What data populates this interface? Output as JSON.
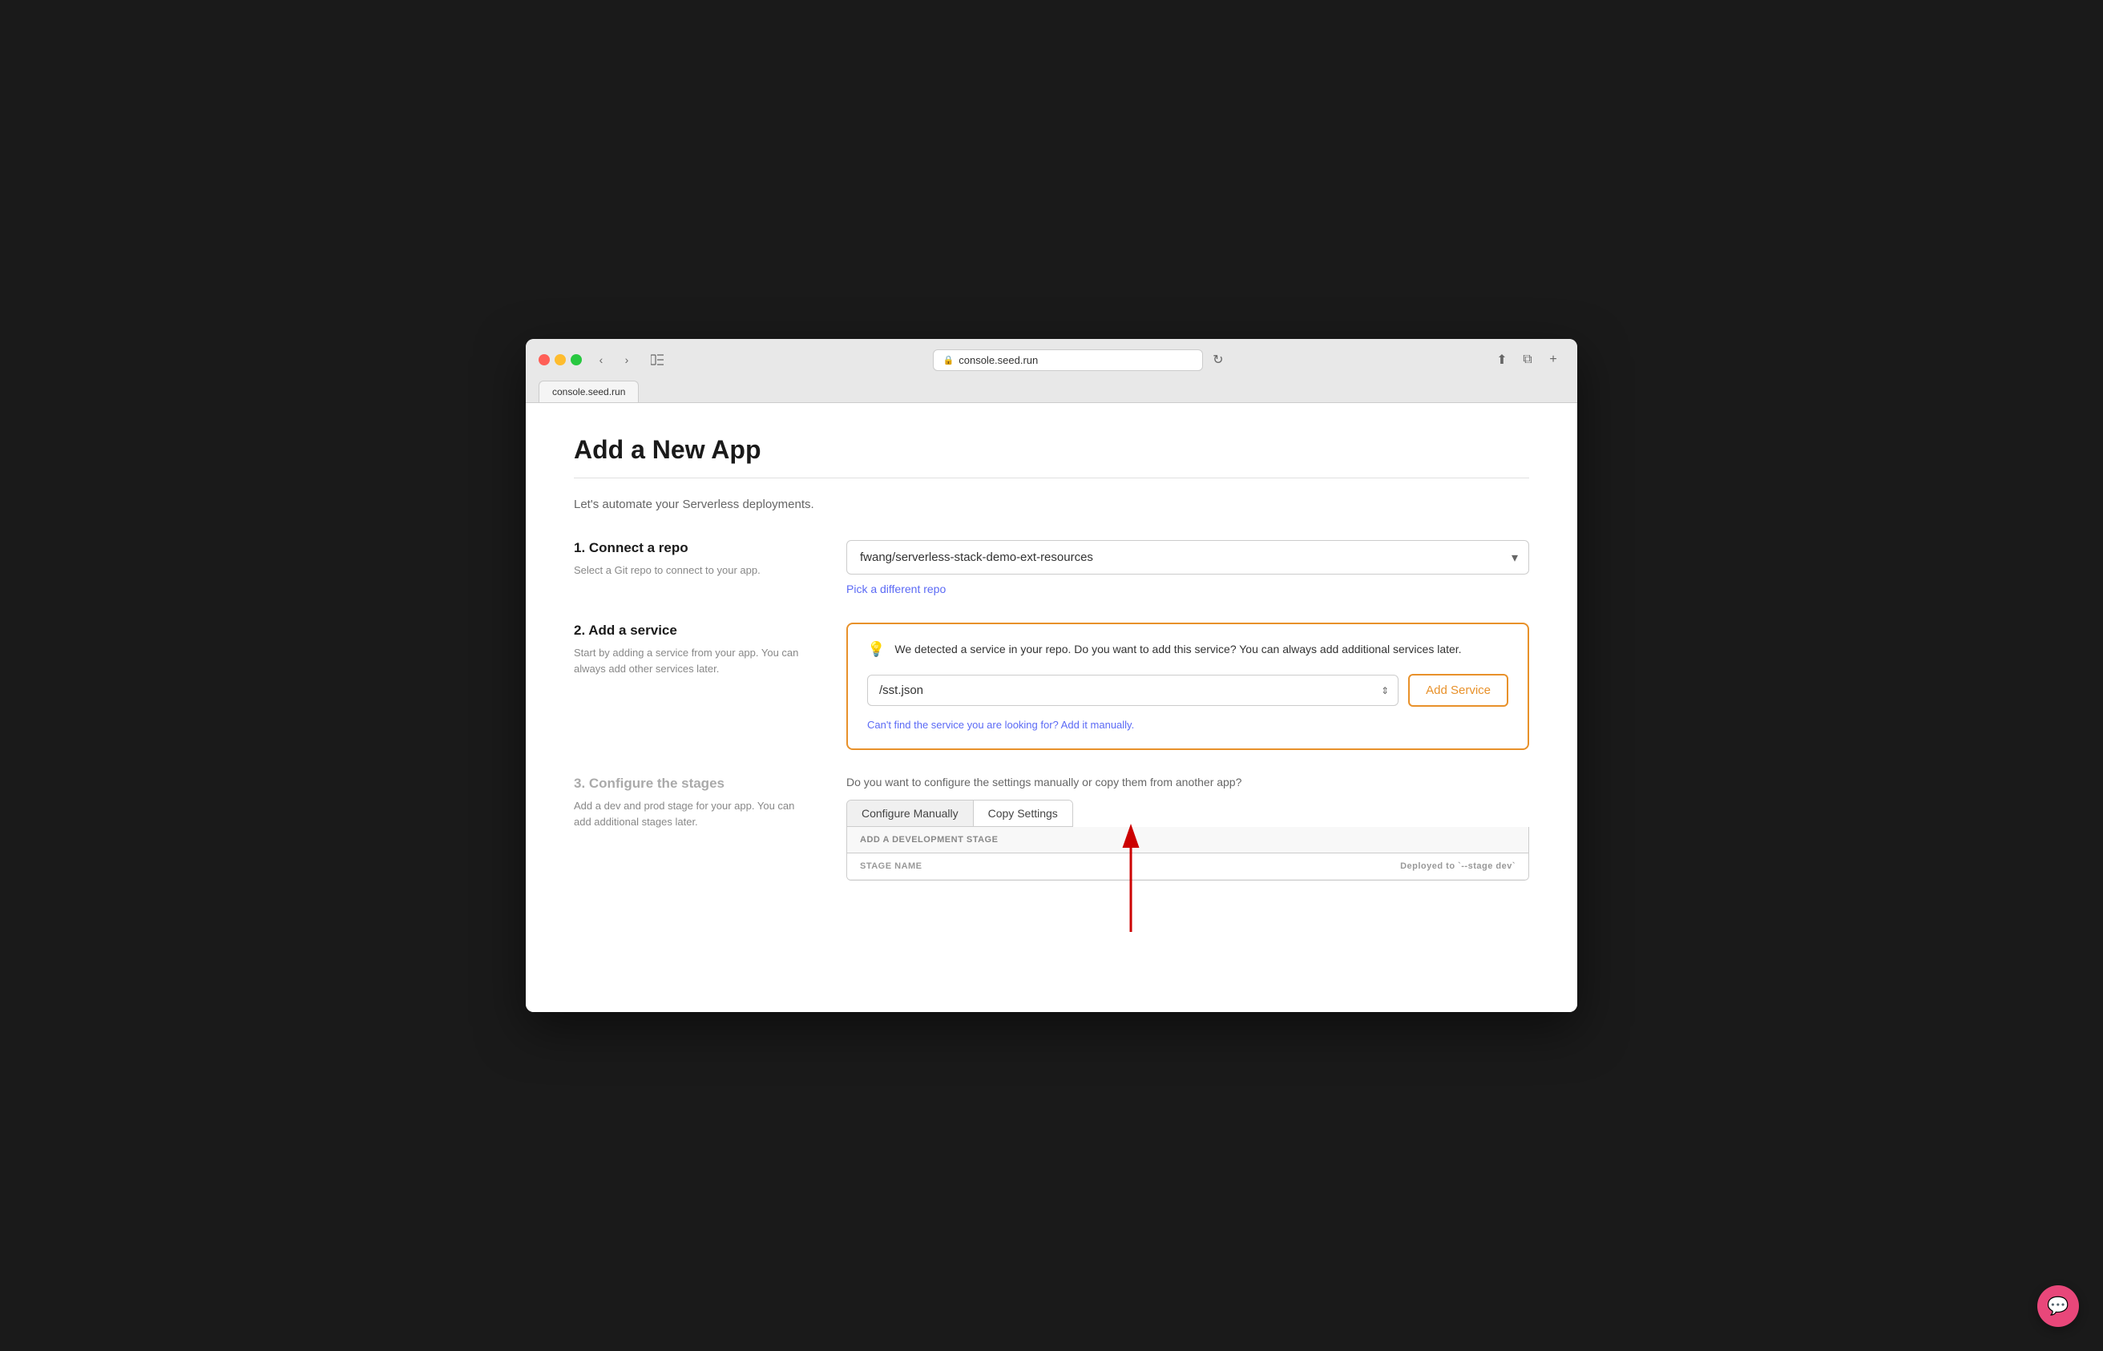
{
  "browser": {
    "url": "console.seed.run",
    "tab_label": "console.seed.run"
  },
  "page": {
    "title": "Add a New App",
    "subtitle": "Let's automate your Serverless deployments."
  },
  "step1": {
    "number_title": "1. Connect a repo",
    "description": "Select a Git repo to connect to your app.",
    "repo_value": "fwang/serverless-stack-demo-ext-resources",
    "pick_repo_link": "Pick a different repo"
  },
  "step2": {
    "number_title": "2. Add a service",
    "description": "Start by adding a service from your app. You can always add other services later.",
    "detection_message": "We detected a service in your repo. Do you want to add this service? You can always add additional services later.",
    "service_value": "/sst.json",
    "add_service_button": "Add Service",
    "manual_link": "Can't find the service you are looking for? Add it manually."
  },
  "step3": {
    "number_title": "3. Configure the stages",
    "description": "Add a dev and prod stage for your app. You can add additional stages later.",
    "configure_question": "Do you want to configure the settings manually or copy them from another app?",
    "tab_configure_manually": "Configure Manually",
    "tab_copy_settings": "Copy Settings",
    "stage_section_header": "ADD A DEVELOPMENT STAGE",
    "col_stage_name": "STAGE NAME",
    "col_deployed_to": "Deployed to `--stage dev`"
  },
  "icons": {
    "lock": "🔒",
    "bulb": "💡",
    "chat": "💬"
  }
}
